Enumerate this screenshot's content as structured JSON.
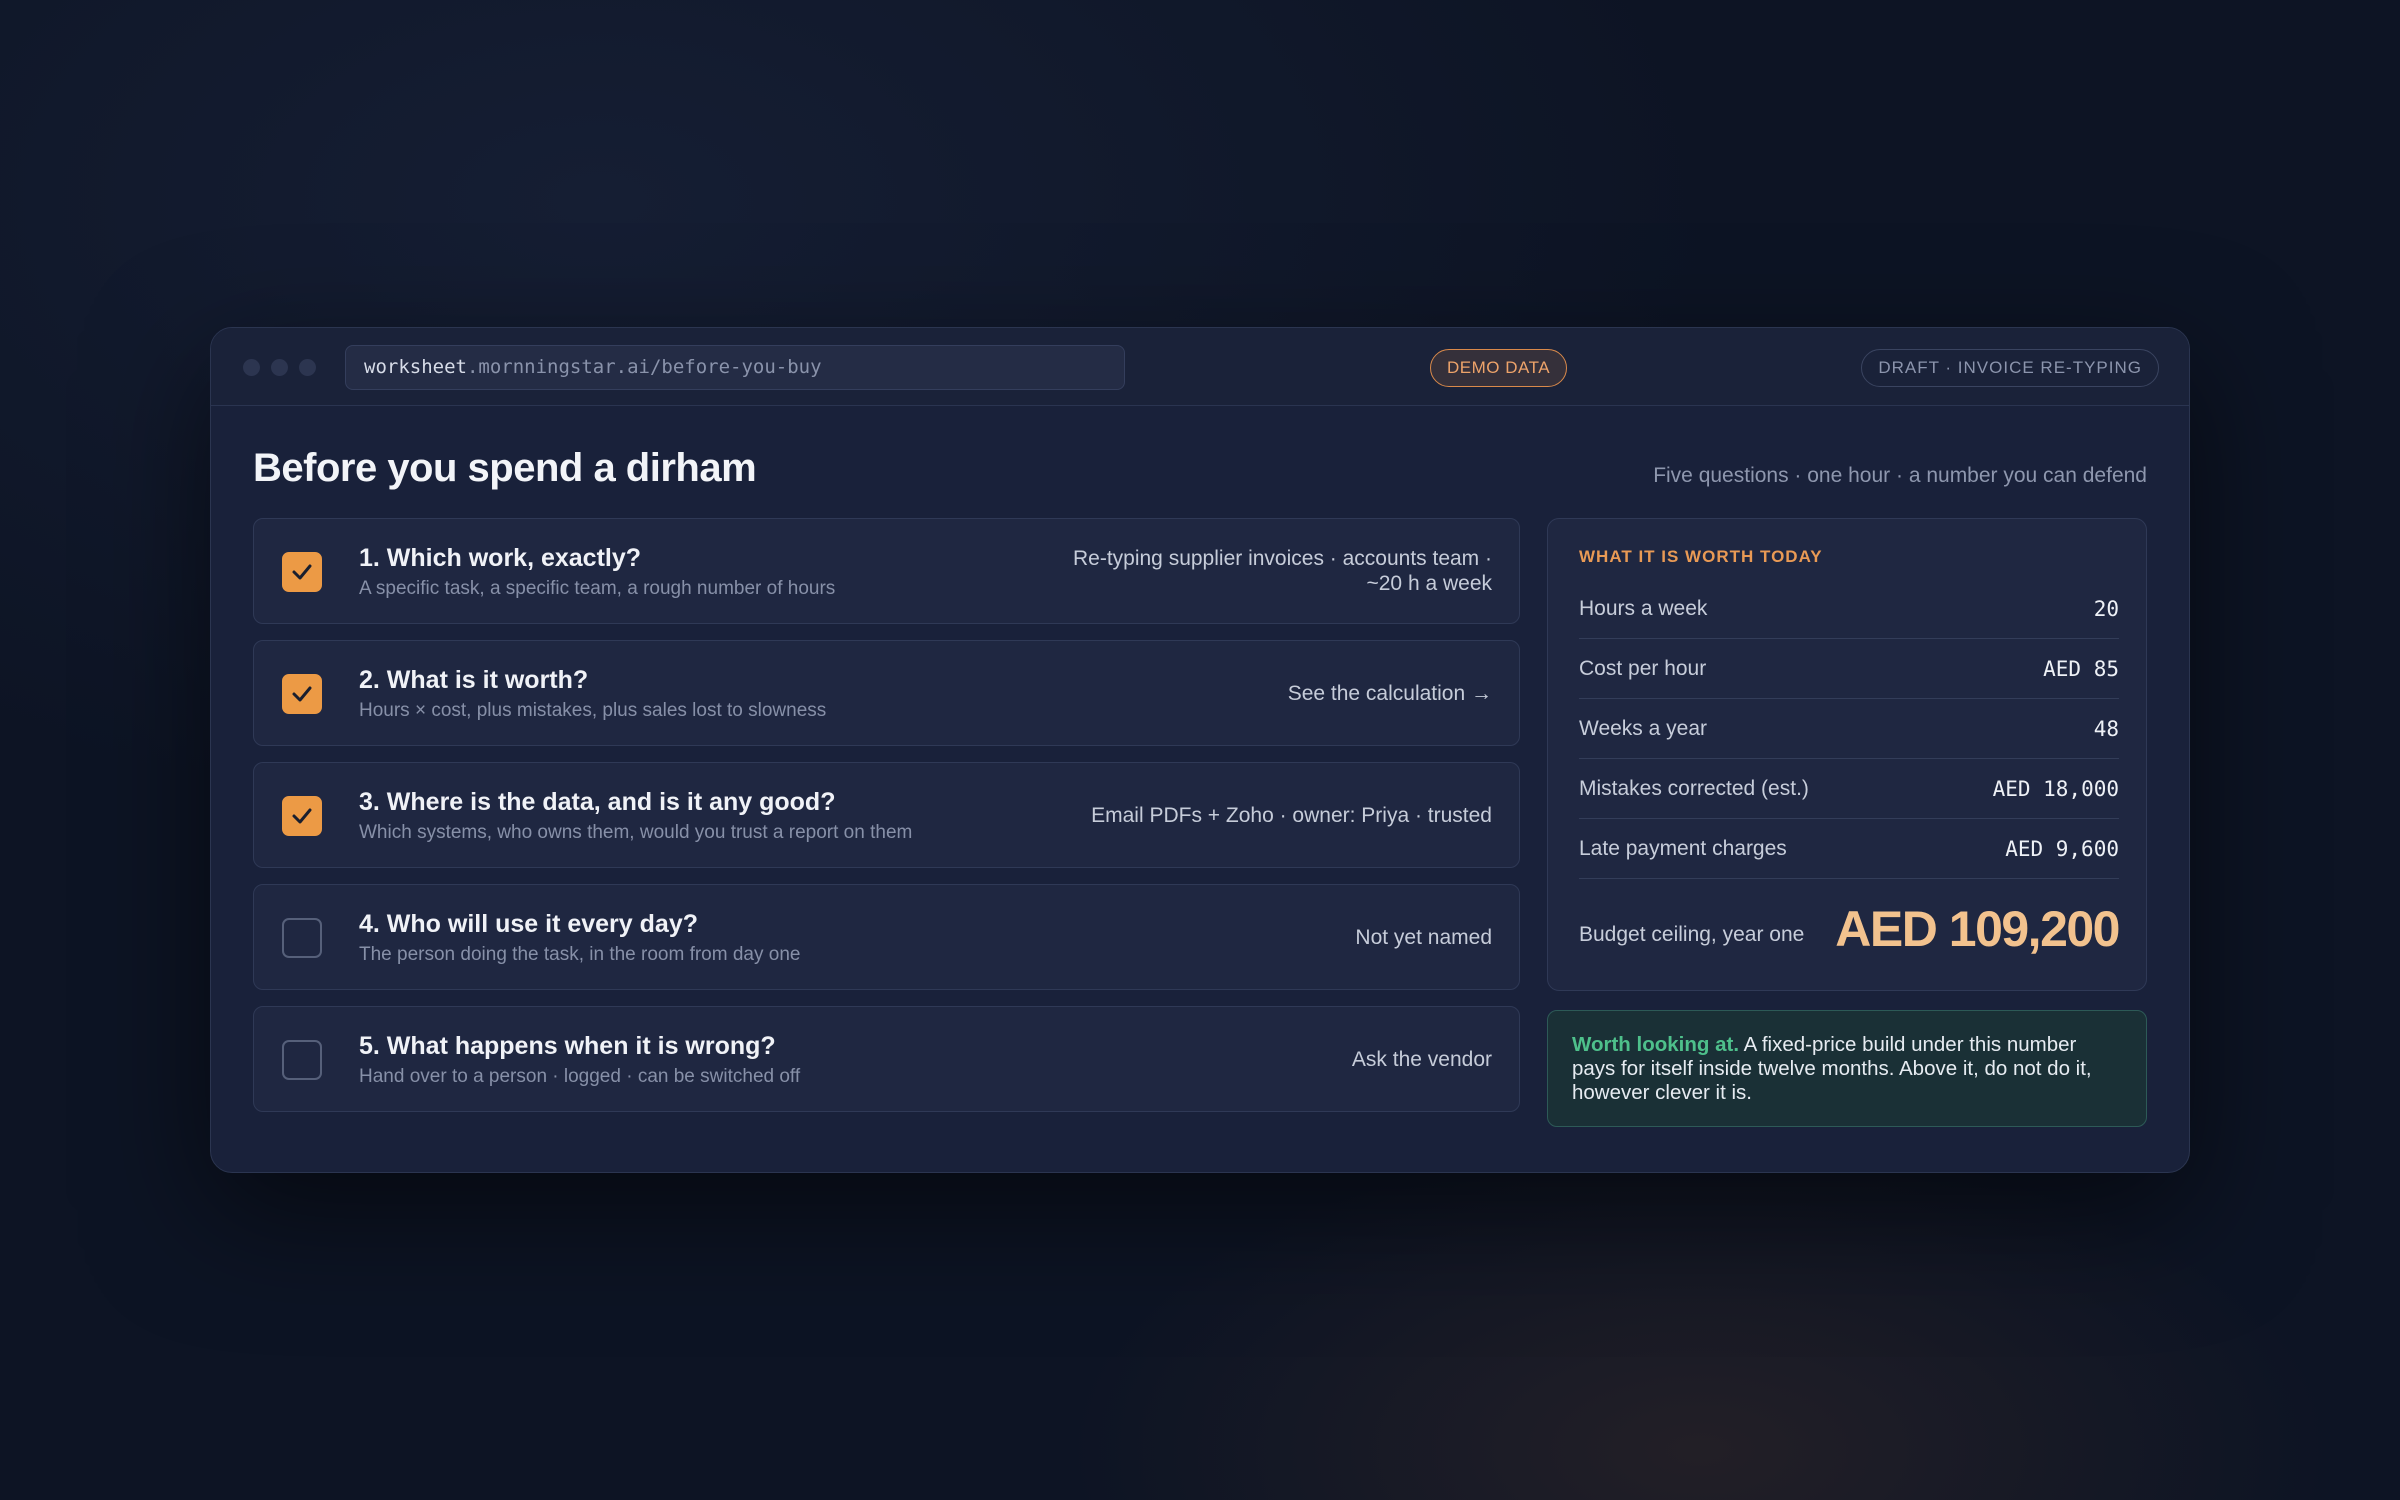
{
  "browser": {
    "url_host": "worksheet",
    "url_rest": ".mornningstar.ai/before-you-buy",
    "demo_badge": "DEMO DATA",
    "draft_badge": "DRAFT · INVOICE RE-TYPING"
  },
  "page": {
    "title": "Before you spend a dirham",
    "tagline": "Five questions · one hour · a number you can defend"
  },
  "questions": [
    {
      "checked": true,
      "title": "1. Which work, exactly?",
      "subtitle": "A specific task, a specific team, a rough number of hours",
      "answer": "Re-typing supplier invoices · accounts team · ~20 h a week"
    },
    {
      "checked": true,
      "title": "2. What is it worth?",
      "subtitle": "Hours × cost, plus mistakes, plus sales lost to slowness",
      "answer": "See the calculation →"
    },
    {
      "checked": true,
      "title": "3. Where is the data, and is it any good?",
      "subtitle": "Which systems, who owns them, would you trust a report on them",
      "answer": "Email PDFs + Zoho · owner: Priya · trusted"
    },
    {
      "checked": false,
      "title": "4. Who will use it every day?",
      "subtitle": "The person doing the task, in the room from day one",
      "answer": "Not yet named"
    },
    {
      "checked": false,
      "title": "5. What happens when it is wrong?",
      "subtitle": "Hand over to a person · logged · can be switched off",
      "answer": "Ask the vendor"
    }
  ],
  "worth": {
    "label": "WHAT IT IS WORTH TODAY",
    "rows": [
      {
        "label": "Hours a week",
        "value": "20"
      },
      {
        "label": "Cost per hour",
        "value": "AED 85"
      },
      {
        "label": "Weeks a year",
        "value": "48"
      },
      {
        "label": "Mistakes corrected (est.)",
        "value": "AED 18,000"
      },
      {
        "label": "Late payment charges",
        "value": "AED 9,600"
      }
    ],
    "total_label": "Budget ceiling, year one",
    "total_value": "AED 109,200"
  },
  "verdict": {
    "lead": "Worth looking at.",
    "body": " A fixed-price build under this number pays for itself inside twelve months. Above it, do not do it, however clever it is."
  },
  "colors": {
    "accent": "#ec9a45",
    "positive": "#4ec08b",
    "total": "#f2c28e"
  }
}
